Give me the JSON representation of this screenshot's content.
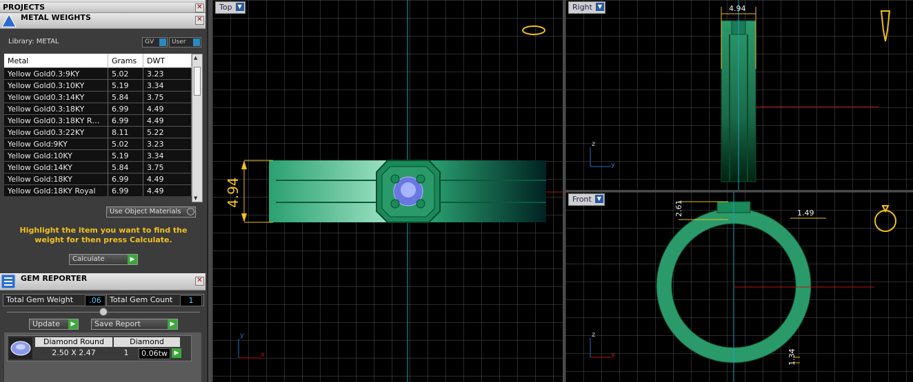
{
  "panels": {
    "projects_title": "PROJECTS",
    "metal_title": "METAL WEIGHTS",
    "gem_title": "GEM REPORTER"
  },
  "metal": {
    "library_label": "Library: METAL",
    "gv_label": "GV",
    "user_label": "User",
    "columns": [
      "Metal",
      "Grams",
      "DWT"
    ],
    "rows": [
      [
        "Yellow Gold0.3:9KY",
        "5.02",
        "3.23"
      ],
      [
        "Yellow Gold0.3:10KY",
        "5.19",
        "3.34"
      ],
      [
        "Yellow Gold0.3:14KY",
        "5.84",
        "3.75"
      ],
      [
        "Yellow Gold0.3:18KY",
        "6.99",
        "4.49"
      ],
      [
        "Yellow Gold0.3:18KY R…",
        "6.99",
        "4.49"
      ],
      [
        "Yellow Gold0.3:22KY",
        "8.11",
        "5.22"
      ],
      [
        "Yellow Gold:9KY",
        "5.02",
        "3.23"
      ],
      [
        "Yellow Gold:10KY",
        "5.19",
        "3.34"
      ],
      [
        "Yellow Gold:14KY",
        "5.84",
        "3.75"
      ],
      [
        "Yellow Gold:18KY",
        "6.99",
        "4.49"
      ],
      [
        "Yellow Gold:18KY Royal",
        "6.99",
        "4.49"
      ]
    ],
    "use_object_materials": "Use Object Materials",
    "hint": "Highlight the item you want to find the weight for then press Calculate.",
    "calculate_label": "Calculate"
  },
  "gem": {
    "total_weight_label": "Total Gem Weight",
    "total_weight_value": ".06",
    "total_count_label": "Total Gem Count",
    "total_count_value": "1",
    "update_label": "Update",
    "save_report_label": "Save Report",
    "shape": "Diamond Round",
    "size": "2.50 X 2.47",
    "material": "Diamond",
    "count": "1",
    "weight": "0.06tw"
  },
  "viewports": {
    "top_label": "Top",
    "right_label": "Right",
    "front_label": "Front",
    "top_dim": "4.94",
    "right_dim": "4.94",
    "front_dim_a": "2.61",
    "front_dim_b": "1.49",
    "front_dim_c": "1.34",
    "axis_x": "x",
    "axis_y": "y",
    "axis_z": "z"
  },
  "colors": {
    "grid": "#555555",
    "metal": "#2a9a6a",
    "dimension": "#f0c020",
    "axis_cyan": "#1aa0c0",
    "axis_red": "#c01010"
  }
}
